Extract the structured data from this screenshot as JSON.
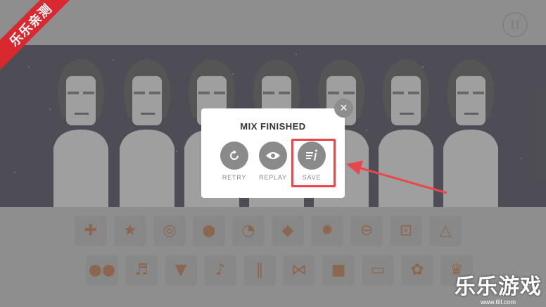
{
  "topbar": {
    "pause_icon": "pause-icon"
  },
  "dialog": {
    "title": "MIX FINISHED",
    "close_icon": "close-icon",
    "actions": [
      {
        "label": "RETRY",
        "icon": "retry-icon"
      },
      {
        "label": "REPLAY",
        "icon": "eye-icon"
      },
      {
        "label": "SAVE",
        "icon": "save-icon"
      }
    ]
  },
  "sounds": {
    "row1": [
      "gamepad-icon",
      "star-icon",
      "ring-icon",
      "bun-icon",
      "clock-icon",
      "leaf-icon",
      "sun-icon",
      "planet-icon",
      "coin-icon",
      "triangle-icon"
    ],
    "row2": [
      "balls-icon",
      "violins-icon",
      "ice-cream-icon",
      "guitar-icon",
      "drumsticks-icon",
      "butterfly-icon",
      "box-icon",
      "tag-icon",
      "flower-icon",
      "crown-icon"
    ]
  },
  "watermark": {
    "ribbon_text": "乐乐亲测",
    "brand_text": "乐乐游戏",
    "brand_url": "www.6ll.com"
  },
  "colors": {
    "accent": "#e8474c",
    "sound_icon": "#a3531e",
    "stage_bg": "#1b1a2b"
  }
}
